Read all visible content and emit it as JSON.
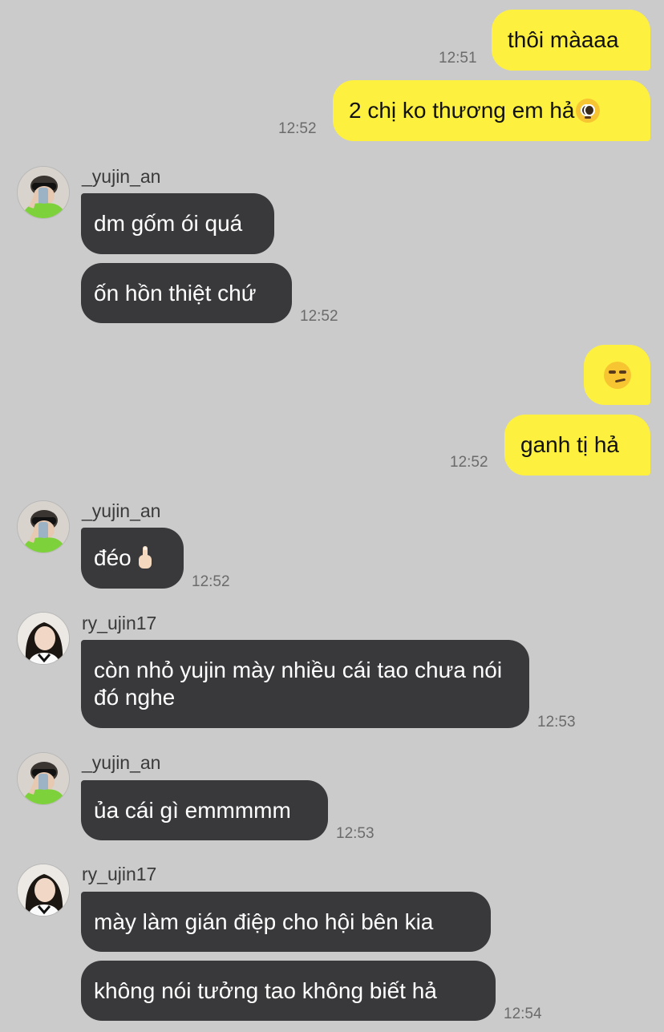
{
  "messages": {
    "m1": {
      "text": "thôi màaaa",
      "time": "12:51"
    },
    "m2": {
      "text": "2 chị ko thương em hả",
      "emoji": "pleading-face",
      "time": "12:52"
    },
    "g1": {
      "sender": "_yujin_an",
      "lines": [
        "dm gốm ói quá",
        "ốn hồn thiệt chứ"
      ],
      "time": "12:52"
    },
    "m3": {
      "emoji": "smirking-face"
    },
    "m4": {
      "text": "ganh tị hả",
      "time": "12:52"
    },
    "g2": {
      "sender": "_yujin_an",
      "text": "đéo",
      "emoji": "middle-finger",
      "time": "12:52"
    },
    "g3": {
      "sender": "ry_ujin17",
      "text": "còn nhỏ yujin mày nhiều cái tao chưa nói đó nghe",
      "time": "12:53"
    },
    "g4": {
      "sender": "_yujin_an",
      "text": "ủa cái gì emmmmm",
      "time": "12:53"
    },
    "g5": {
      "sender": "ry_ujin17",
      "lines": [
        "mày làm gián điệp cho hội bên kia",
        "không nói tưởng tao không biết hả"
      ],
      "time": "12:54"
    }
  },
  "colors": {
    "background": "#cbcbcb",
    "outgoing": "#fef03f",
    "incoming": "#39393c"
  }
}
